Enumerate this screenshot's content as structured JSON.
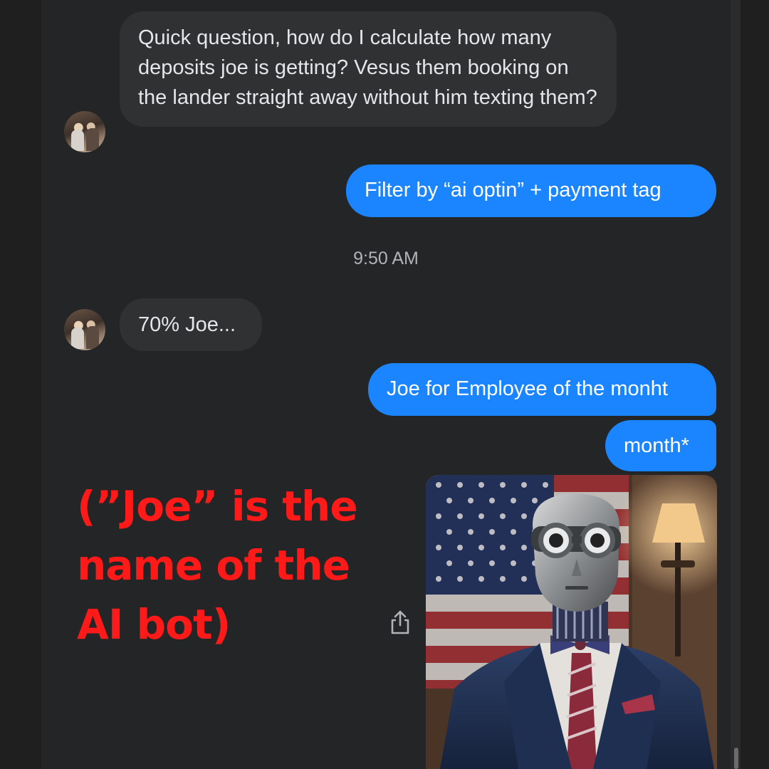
{
  "conversation": {
    "messages": [
      {
        "direction": "incoming",
        "text": "Quick question, how do I calculate how many deposits joe is getting?  Vesus them booking on the lander straight away without him texting them?"
      },
      {
        "direction": "outgoing",
        "text": "Filter by “ai optin” + payment tag"
      },
      {
        "direction": "incoming",
        "text": "70% Joe..."
      },
      {
        "direction": "outgoing",
        "text": "Joe for Employee of the monht"
      },
      {
        "direction": "outgoing",
        "text": "month*"
      }
    ],
    "timestamp": "9:50 AM"
  },
  "annotation": {
    "text": "(”Joe” is the name of the AI bot)",
    "color": "#ff1a1a"
  },
  "icons": {
    "share": "share-icon",
    "avatar": "avatar"
  },
  "colors": {
    "background": "#242526",
    "incoming_bubble": "#303132",
    "outgoing_bubble": "#1a85ff"
  }
}
